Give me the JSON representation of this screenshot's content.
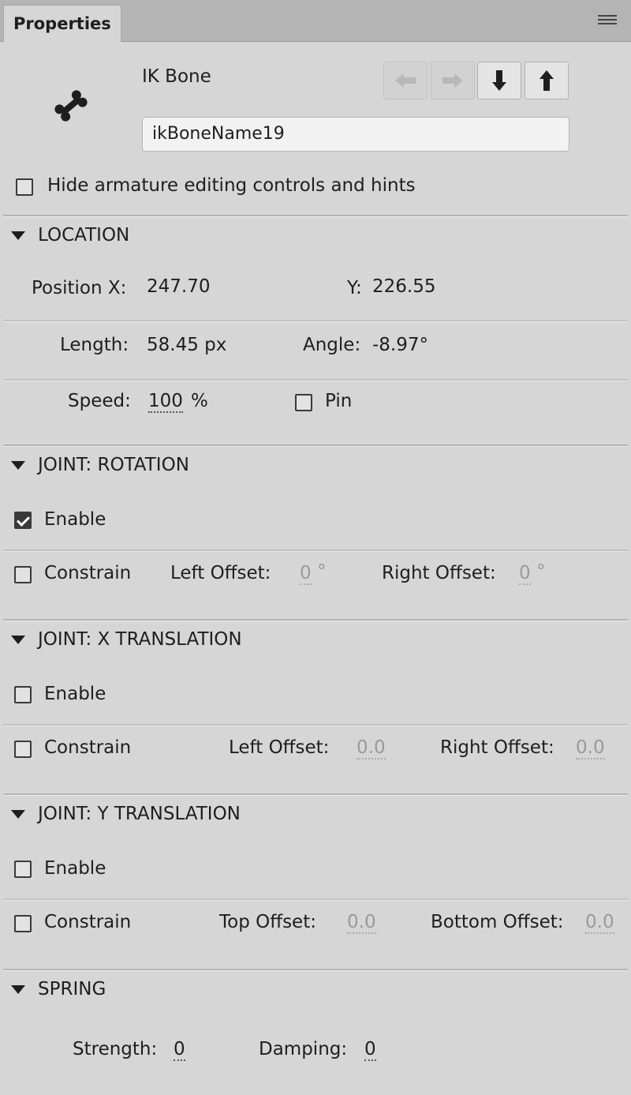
{
  "tab": {
    "title": "Properties"
  },
  "header": {
    "title": "IK Bone",
    "bone_name": "ikBoneName19",
    "hide_controls_label": "Hide armature editing controls and hints",
    "hide_controls_checked": false
  },
  "location": {
    "heading": "LOCATION",
    "position_x_label": "Position X:",
    "position_x_value": "247.70",
    "y_label": "Y:",
    "y_value": "226.55",
    "length_label": "Length:",
    "length_value": "58.45 px",
    "angle_label": "Angle:",
    "angle_value": "-8.97°",
    "speed_label": "Speed:",
    "speed_value": "100",
    "speed_unit": "%",
    "pin_label": "Pin",
    "pin_checked": false
  },
  "rotation": {
    "heading": "JOINT: ROTATION",
    "enable_label": "Enable",
    "enable_checked": true,
    "constrain_label": "Constrain",
    "constrain_checked": false,
    "left_offset_label": "Left Offset:",
    "left_offset_value": "0",
    "left_offset_unit": "°",
    "right_offset_label": "Right Offset:",
    "right_offset_value": "0",
    "right_offset_unit": "°"
  },
  "x_translation": {
    "heading": "JOINT: X TRANSLATION",
    "enable_label": "Enable",
    "enable_checked": false,
    "constrain_label": "Constrain",
    "constrain_checked": false,
    "left_offset_label": "Left Offset:",
    "left_offset_value": "0.0",
    "right_offset_label": "Right Offset:",
    "right_offset_value": "0.0"
  },
  "y_translation": {
    "heading": "JOINT: Y TRANSLATION",
    "enable_label": "Enable",
    "enable_checked": false,
    "constrain_label": "Constrain",
    "constrain_checked": false,
    "top_offset_label": "Top Offset:",
    "top_offset_value": "0.0",
    "bottom_offset_label": "Bottom Offset:",
    "bottom_offset_value": "0.0"
  },
  "spring": {
    "heading": "SPRING",
    "strength_label": "Strength:",
    "strength_value": "0",
    "damping_label": "Damping:",
    "damping_value": "0"
  },
  "icons": {
    "bone": "bone-icon",
    "prev_sibling": "arrow-left-icon",
    "next_sibling": "arrow-right-icon",
    "child": "arrow-down-icon",
    "parent": "arrow-up-icon",
    "panel_menu": "panel-menu-icon",
    "collapse": "triangle-down-icon"
  },
  "colors": {
    "panel_bg": "#d6d6d6",
    "tabbar_bg": "#b4b4b4",
    "text": "#1e1e1e",
    "disabled_text": "#9a9a9a"
  }
}
